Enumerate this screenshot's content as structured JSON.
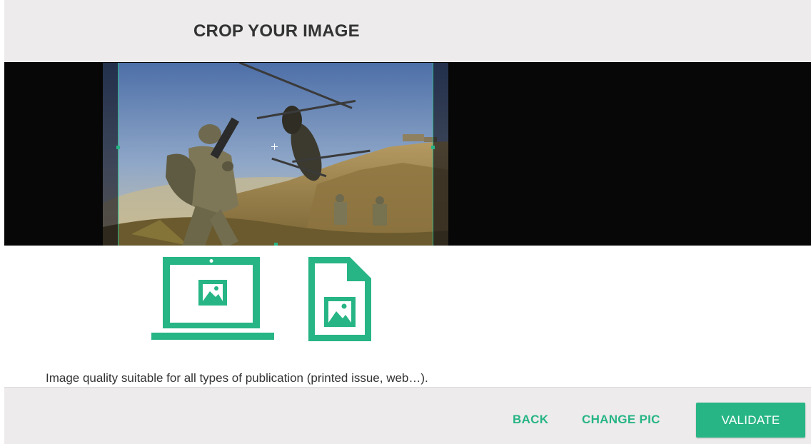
{
  "header": {
    "title": "CROP YOUR IMAGE"
  },
  "cropper": {
    "image_alt": "military-helicopter-photo",
    "icons": [
      "laptop-image-icon",
      "document-image-icon"
    ]
  },
  "quality_message": "Image quality suitable for all types of publication (printed issue, web…).",
  "footer": {
    "back_label": "BACK",
    "change_label": "CHANGE PIC",
    "validate_label": "VALIDATE"
  },
  "colors": {
    "accent": "#27b585",
    "header_bg": "#edebec",
    "viewport_bg": "#070707"
  }
}
